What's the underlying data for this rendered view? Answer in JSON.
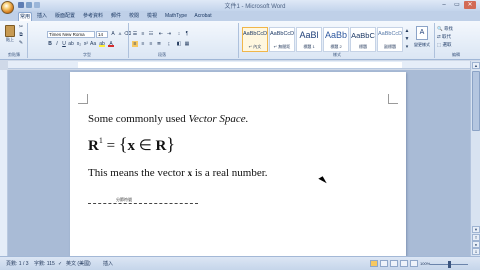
{
  "title": "文件1 - Microsoft Word",
  "window": {
    "minimize": "–",
    "restore": "▭",
    "close": "✕"
  },
  "tabs": [
    {
      "label": "常用",
      "active": true
    },
    {
      "label": "插入"
    },
    {
      "label": "版面配置"
    },
    {
      "label": "參考資料"
    },
    {
      "label": "郵件"
    },
    {
      "label": "校閱"
    },
    {
      "label": "檢視"
    },
    {
      "label": "MathType"
    },
    {
      "label": "Acrobat"
    }
  ],
  "ribbon": {
    "clipboard": {
      "paste_label": "貼上",
      "group_label": "剪貼簿"
    },
    "font": {
      "name": "Times New Roma",
      "size": "14",
      "group_label": "字型"
    },
    "paragraph": {
      "group_label": "段落"
    },
    "styles": {
      "group_label": "樣式",
      "tiles": [
        {
          "sample": "AaBbCcD",
          "name": "↵ 內文",
          "selected": true
        },
        {
          "sample": "AaBbCcD",
          "name": "↵ 無間距"
        },
        {
          "sample": "AaBl",
          "name": "標題 1"
        },
        {
          "sample": "AaBb",
          "name": "標題 2"
        },
        {
          "sample": "AaBbC",
          "name": "標題"
        },
        {
          "sample": "AaBbCcD",
          "name": "副標題"
        }
      ],
      "change_label": "變更樣式"
    },
    "editing": {
      "group_label": "編輯",
      "find": "尋找",
      "replace": "取代",
      "select": "選取"
    }
  },
  "document": {
    "line1_plain": "Some commonly used ",
    "line1_italic": "Vector Space.",
    "formula_lhs_bold": "R",
    "formula_sup": "1",
    "formula_eq": " = ",
    "formula_brace_open": "{",
    "formula_x": "x",
    "formula_in": " ∈ ",
    "formula_R": "R",
    "formula_brace_close": "}",
    "line3_a": "This means the vector ",
    "line3_vec": "x",
    "line3_b": " is a real number.",
    "page_break_label": "分節符號"
  },
  "statusbar": {
    "page": "頁數: 1 / 3",
    "words": "字數: 115",
    "language": "英文 (美國)",
    "mode": "插入",
    "zoom": "100%"
  },
  "colors": {
    "ribbon_bg": "#dbe6f4",
    "page_bg": "#ffffff",
    "workspace_bg": "#a9bbd6",
    "accent": "#f0b64a"
  }
}
